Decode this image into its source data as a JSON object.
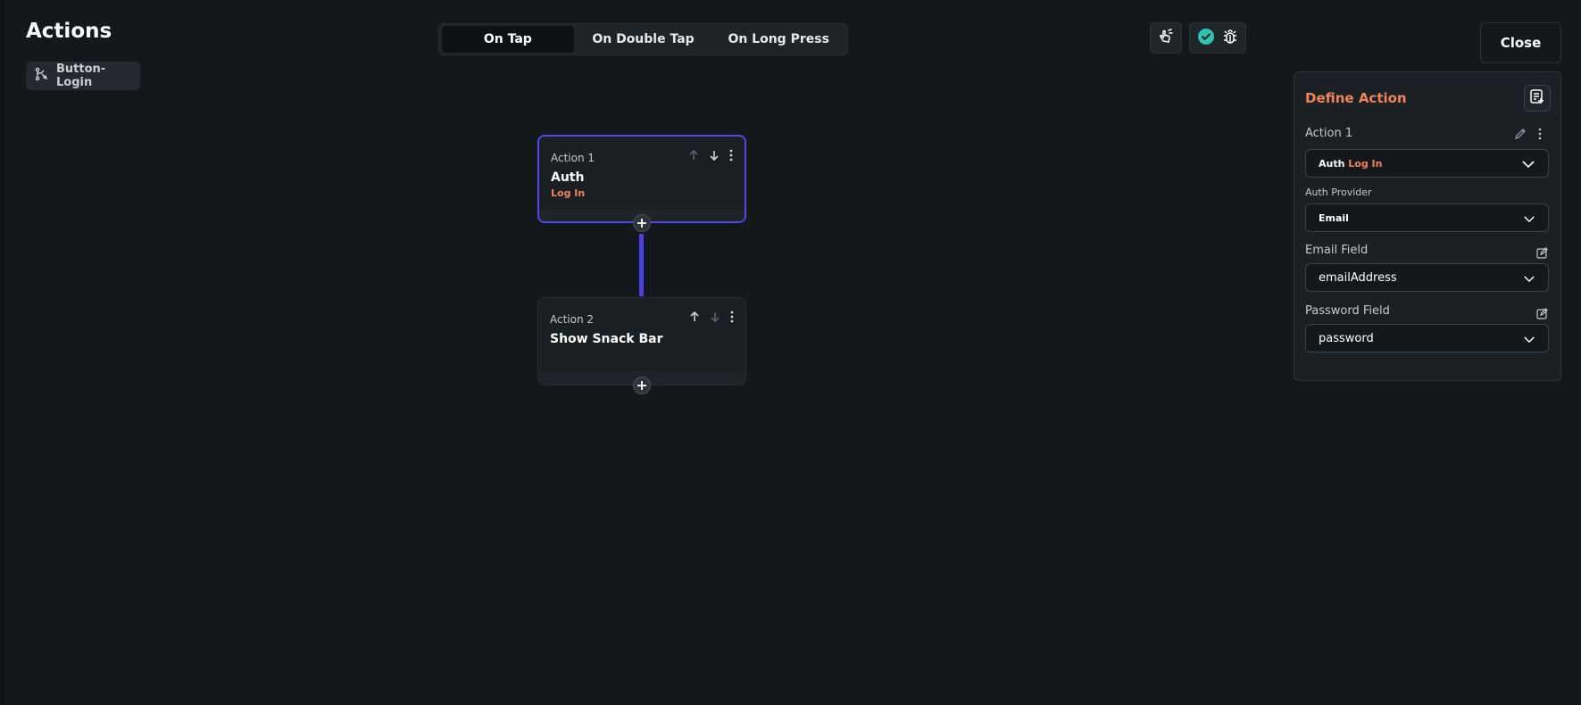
{
  "header": {
    "title": "Actions",
    "widget_name": "Button-Login"
  },
  "tabs": [
    {
      "label": "On Tap",
      "active": true
    },
    {
      "label": "On Double Tap",
      "active": false
    },
    {
      "label": "On Long Press",
      "active": false
    }
  ],
  "toolbar": {
    "close_label": "Close"
  },
  "flow": {
    "nodes": [
      {
        "label": "Action 1",
        "name": "Auth",
        "subtitle": "Log In"
      },
      {
        "label": "Action 2",
        "name": "Show Snack Bar",
        "subtitle": ""
      }
    ]
  },
  "panel": {
    "title": "Define Action",
    "action_label": "Action 1",
    "action_type": "Auth",
    "action_subtype": "Log In",
    "auth_provider_label": "Auth Provider",
    "auth_provider_value": "Email",
    "email_field_label": "Email Field",
    "email_field_value": "emailAddress",
    "password_field_label": "Password Field",
    "password_field_value": "password"
  },
  "colors": {
    "accent": "#4f47e6",
    "orange": "#f0845b",
    "success": "#2fc3b2",
    "background": "#14181b"
  }
}
